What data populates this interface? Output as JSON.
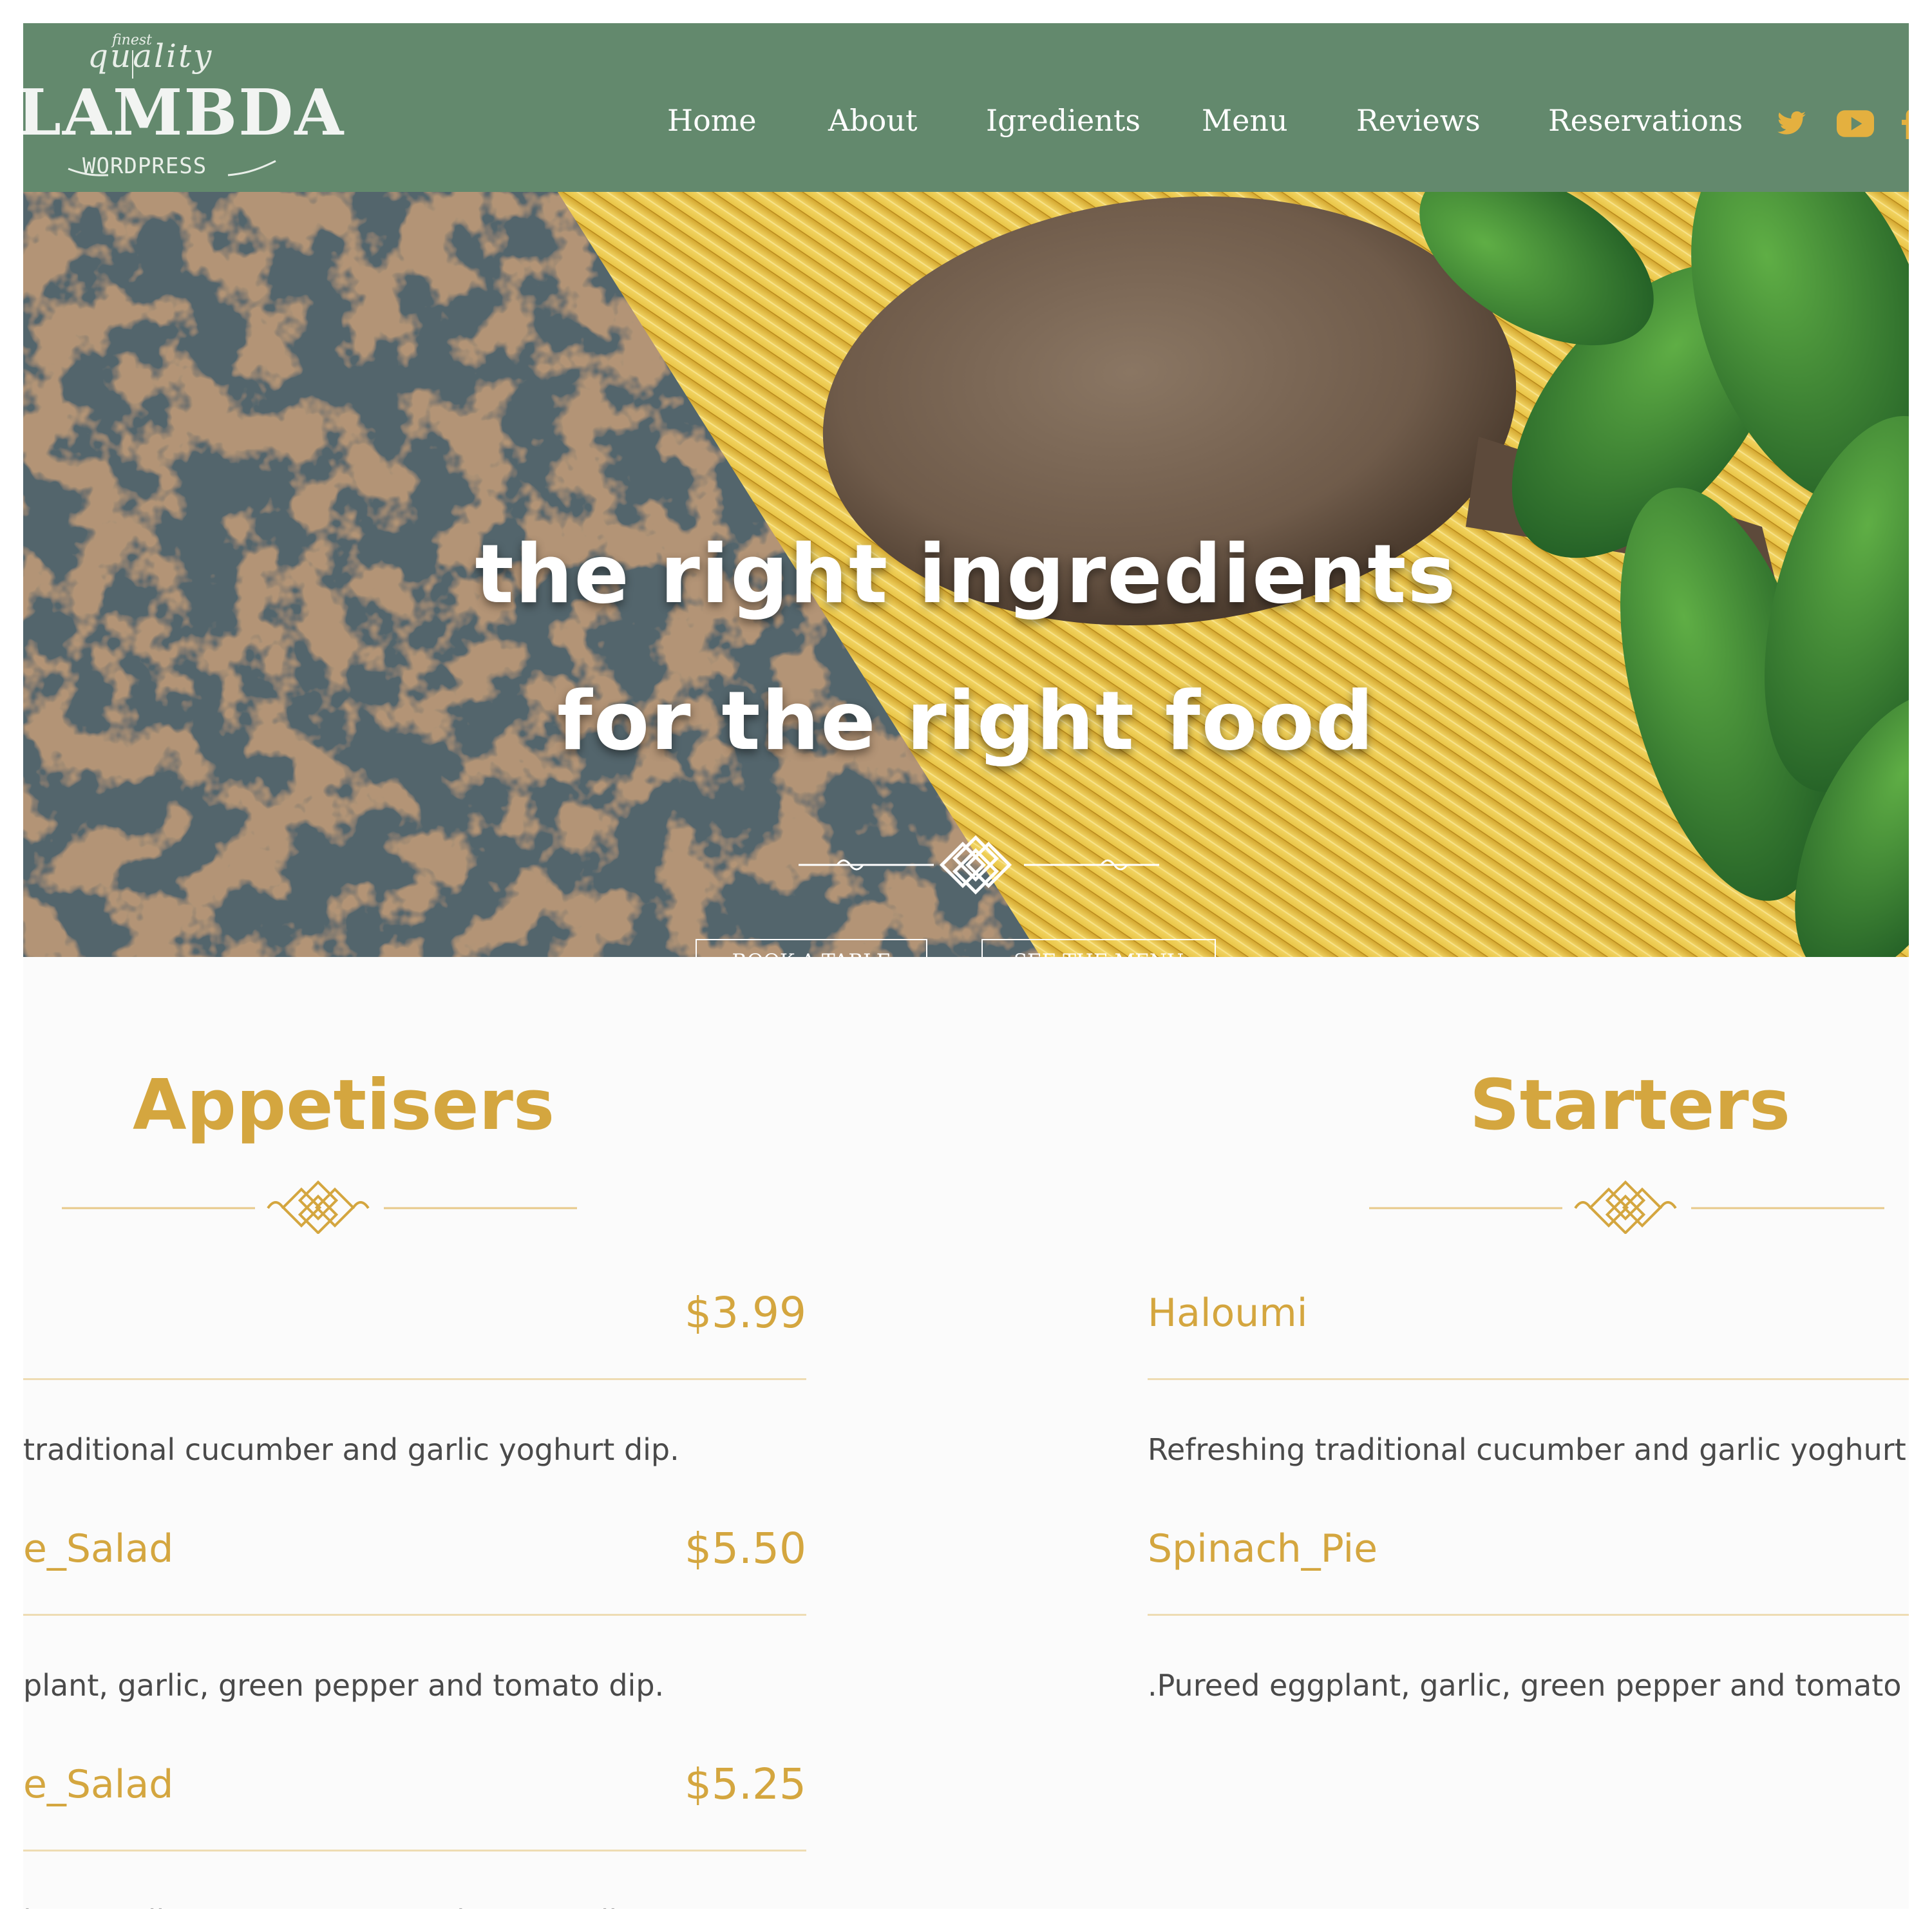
{
  "brand": {
    "tagline_small": "finest",
    "tagline": "quality",
    "name": "LAMBDA",
    "sub": "WORDPRESS",
    "color": "#63896d"
  },
  "nav": {
    "items": [
      {
        "label": "Home"
      },
      {
        "label": "About"
      },
      {
        "label": "Igredients"
      },
      {
        "label": "Menu"
      },
      {
        "label": "Reviews"
      },
      {
        "label": "Reservations"
      }
    ],
    "social_icons": [
      "twitter-icon",
      "youtube-icon",
      "facebook-icon"
    ],
    "social_color": "#e4b03f"
  },
  "hero": {
    "line1": "the right ingredients",
    "line2": "for the right food",
    "book_button": "BOOK A TABLE",
    "menu_button": "SEE THE MENU"
  },
  "menu": {
    "accent": "#d4a63f",
    "appetisers": {
      "title": "Appetisers",
      "items": [
        {
          "name": "",
          "price": "$3.99",
          "desc": "traditional cucumber and garlic yoghurt dip."
        },
        {
          "name": "e_Salad",
          "price": "$5.50",
          "desc": "plant, garlic, green pepper and tomato dip."
        },
        {
          "name": "e_Salad",
          "price": "$5.25",
          "desc": "lant, garlic, green pepper and tomato dip."
        }
      ]
    },
    "starters": {
      "title": "Starters",
      "items": [
        {
          "name": "Haloumi",
          "desc": "Refreshing traditional cucumber and garlic yoghurt"
        },
        {
          "name": "Spinach_Pie",
          "desc": ".Pureed eggplant, garlic, green pepper and tomato d"
        }
      ]
    }
  }
}
